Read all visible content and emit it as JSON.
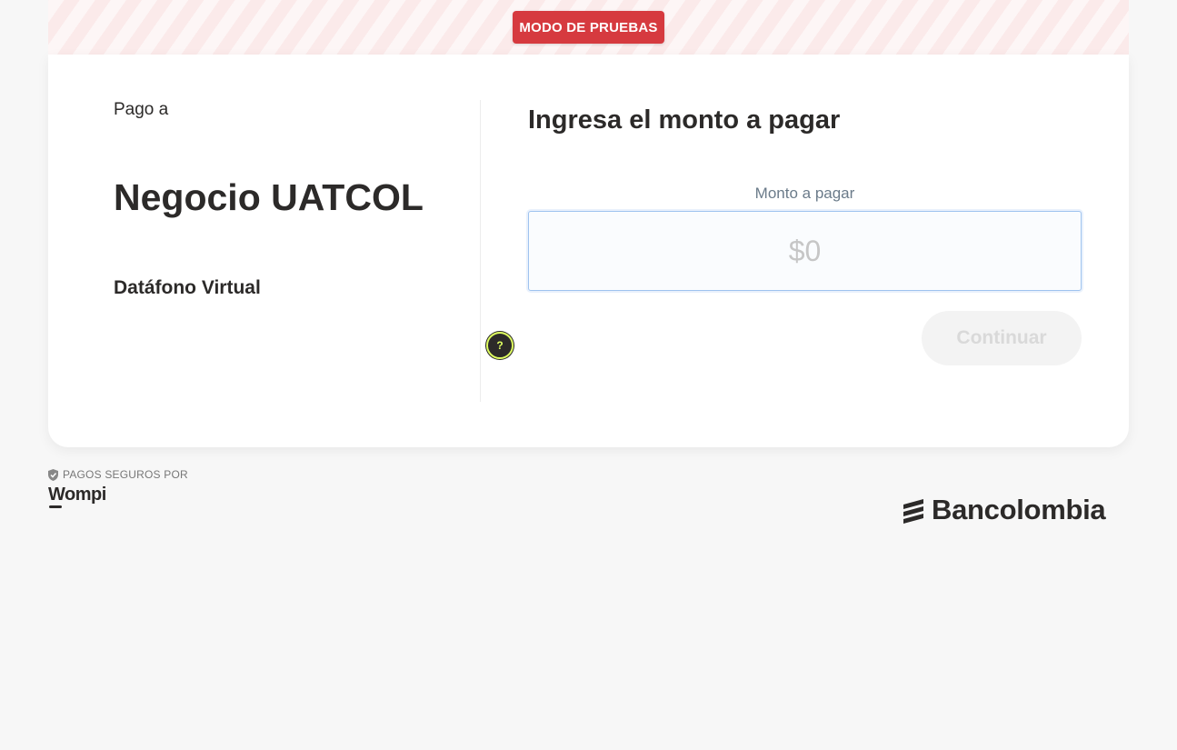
{
  "banner": {
    "badge_label": "MODO DE PRUEBAS",
    "badge_color": "#d63a3f"
  },
  "merchant": {
    "pay_to_label": "Pago a",
    "name": "Negocio UATCOL",
    "product": "Datáfono Virtual",
    "help_glyph": "?",
    "help_icon": "question-circle-icon"
  },
  "payment": {
    "title": "Ingresa el monto a pagar",
    "amount_label": "Monto a pagar",
    "amount_value": "",
    "amount_placeholder": "$0",
    "continue_label": "Continuar",
    "continue_enabled": false
  },
  "footer": {
    "secure_label": "PAGOS SEGUROS POR",
    "secure_icon": "shield-check-icon",
    "provider_logo": "Wompi",
    "bank_logo": "Bancolombia",
    "bank_icon": "bancolombia-bars-icon"
  },
  "colors": {
    "background": "#f7f7f7",
    "card": "#ffffff",
    "text": "#2c2a29",
    "help_accent": "#dfff61",
    "input_border": "#9fc3ef"
  }
}
